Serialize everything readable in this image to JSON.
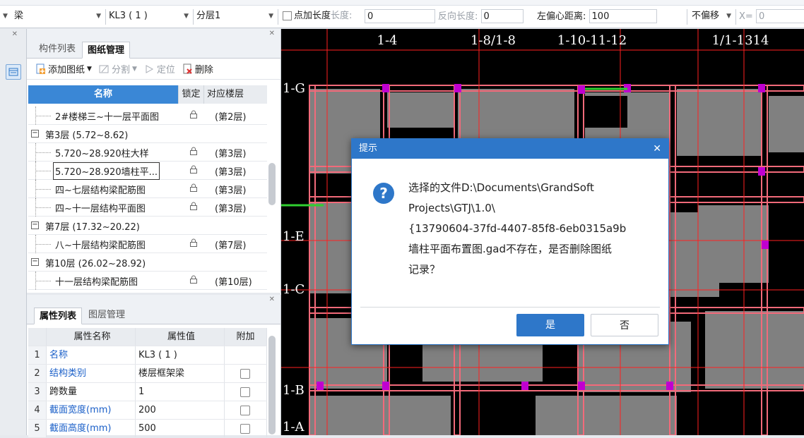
{
  "toolbar": {
    "element_type": "梁",
    "component": "KL3 ( 1 )",
    "layer": "分层1",
    "add_length_label": "点加长度",
    "length_label": "长度:",
    "length_value": "0",
    "reverse_length_label": "反向长度:",
    "reverse_length_value": "0",
    "left_offset_label": "左偏心距离:",
    "left_offset_value": "100",
    "offset_mode": "不偏移",
    "x_label": "X=",
    "x_value": "0"
  },
  "drawing_panel": {
    "tabs": [
      "构件列表",
      "图纸管理"
    ],
    "active_tab": "图纸管理",
    "tools": {
      "add": "添加图纸",
      "split": "分割",
      "locate": "定位",
      "delete": "删除"
    },
    "columns": {
      "name": "名称",
      "lock": "锁定",
      "floor": "对应楼层"
    },
    "rows": [
      {
        "kind": "item",
        "name": "2#楼梯三~十一层平面图",
        "floor": "(第2层)"
      },
      {
        "kind": "group",
        "name": "第3层 (5.72~8.62)"
      },
      {
        "kind": "item",
        "name": "5.720~28.920柱大样",
        "floor": "(第3层)"
      },
      {
        "kind": "item",
        "name": "5.720~28.920墙柱平...",
        "floor": "(第3层)",
        "selected": true
      },
      {
        "kind": "item",
        "name": "四~七层结构梁配筋图",
        "floor": "(第3层)"
      },
      {
        "kind": "item",
        "name": "四~十一层结构平面图",
        "floor": "(第3层)"
      },
      {
        "kind": "group",
        "name": "第7层 (17.32~20.22)"
      },
      {
        "kind": "item",
        "name": "八~十层结构梁配筋图",
        "floor": "(第7层)"
      },
      {
        "kind": "group",
        "name": "第10层 (26.02~28.92)"
      },
      {
        "kind": "item",
        "name": "十一层结构梁配筋图",
        "floor": "(第10层)"
      }
    ]
  },
  "property_panel": {
    "tabs": [
      "属性列表",
      "图层管理"
    ],
    "active_tab": "属性列表",
    "columns": {
      "name": "属性名称",
      "value": "属性值",
      "extra": "附加"
    },
    "rows": [
      {
        "no": "1",
        "name": "名称",
        "value": "KL3 ( 1 )",
        "blue": true,
        "check": false
      },
      {
        "no": "2",
        "name": "结构类别",
        "value": "楼层框架梁",
        "blue": true,
        "check": true
      },
      {
        "no": "3",
        "name": "跨数量",
        "value": "1",
        "blue": false,
        "check": true
      },
      {
        "no": "4",
        "name": "截面宽度(mm)",
        "value": "200",
        "blue": true,
        "check": true
      },
      {
        "no": "5",
        "name": "截面高度(mm)",
        "value": "500",
        "blue": true,
        "check": true
      }
    ]
  },
  "canvas": {
    "axis_labels_top": [
      "1-4",
      "1-8/1-8",
      "1-10-11-12",
      "1/1-1314"
    ],
    "axis_labels_left": [
      "1-G",
      "1-E",
      "1-C",
      "1-B",
      "1-A"
    ]
  },
  "dialog": {
    "title": "提示",
    "message_lines": [
      "选择的文件D:\\Documents\\GrandSoft",
      "Projects\\GTJ\\1.0\\",
      "{13790604-37fd-4407-85f8-6eb0315a9b",
      "墙柱平面布置图.gad不存在，是否删除图纸",
      "记录？"
    ],
    "yes": "是",
    "no": "否"
  },
  "colors": {
    "accent": "#2e77c9",
    "wall_outline": "#f26a7a",
    "column": "#c000d0",
    "axis": "#ff2020",
    "slab": "#808080"
  }
}
